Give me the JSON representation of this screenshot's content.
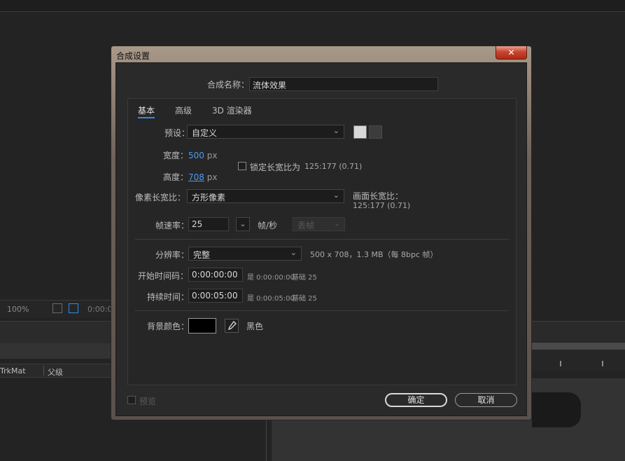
{
  "background": {
    "zoom": "100%",
    "timecode_stub": "0:00:0",
    "columns": {
      "trkmat": "TrkMat",
      "parent": "父级"
    }
  },
  "dialog": {
    "title": "合成设置",
    "close_glyph": "✕",
    "comp_name": {
      "label": "合成名称：",
      "value": "流体效果"
    },
    "tabs": [
      {
        "label": "基本",
        "active": true
      },
      {
        "label": "高级",
        "active": false
      },
      {
        "label": "3D 渲染器",
        "active": false
      }
    ],
    "preset": {
      "label": "预设：",
      "value": "自定义"
    },
    "width": {
      "label": "宽度：",
      "value": "500",
      "unit": "px"
    },
    "height": {
      "label": "高度：",
      "value": "708",
      "unit": "px"
    },
    "lock_aspect": {
      "label": "锁定长宽比为",
      "ratio": "125:177 (0.71)",
      "checked": false
    },
    "pixel_aspect": {
      "label": "像素长宽比：",
      "value": "方形像素"
    },
    "frame_aspect": {
      "label": "画面长宽比：",
      "value": "125:177 (0.71)"
    },
    "frame_rate": {
      "label": "帧速率：",
      "value": "25",
      "unit": "帧/秒",
      "drop_frame": "丢帧"
    },
    "resolution": {
      "label": "分辨率：",
      "value": "完整",
      "info": "500 x 708，1.3 MB（每 8bpc 帧）"
    },
    "start_timecode": {
      "label": "开始时间码：",
      "value": "0:00:00:00",
      "eq": "是 0:00:00:00",
      "base": "基础 25"
    },
    "duration": {
      "label": "持续时间：",
      "value": "0:00:05:00",
      "eq": "是 0:00:05:00",
      "base": "基础 25"
    },
    "bg_color": {
      "label": "背景颜色：",
      "name": "黑色",
      "hex": "#000000"
    },
    "preview": {
      "label": "预览",
      "checked": false
    },
    "ok_label": "确定",
    "cancel_label": "取消"
  },
  "colors": {
    "accent": "#2d8ceb",
    "link": "#4a9bf5",
    "close": "#c9452f"
  }
}
